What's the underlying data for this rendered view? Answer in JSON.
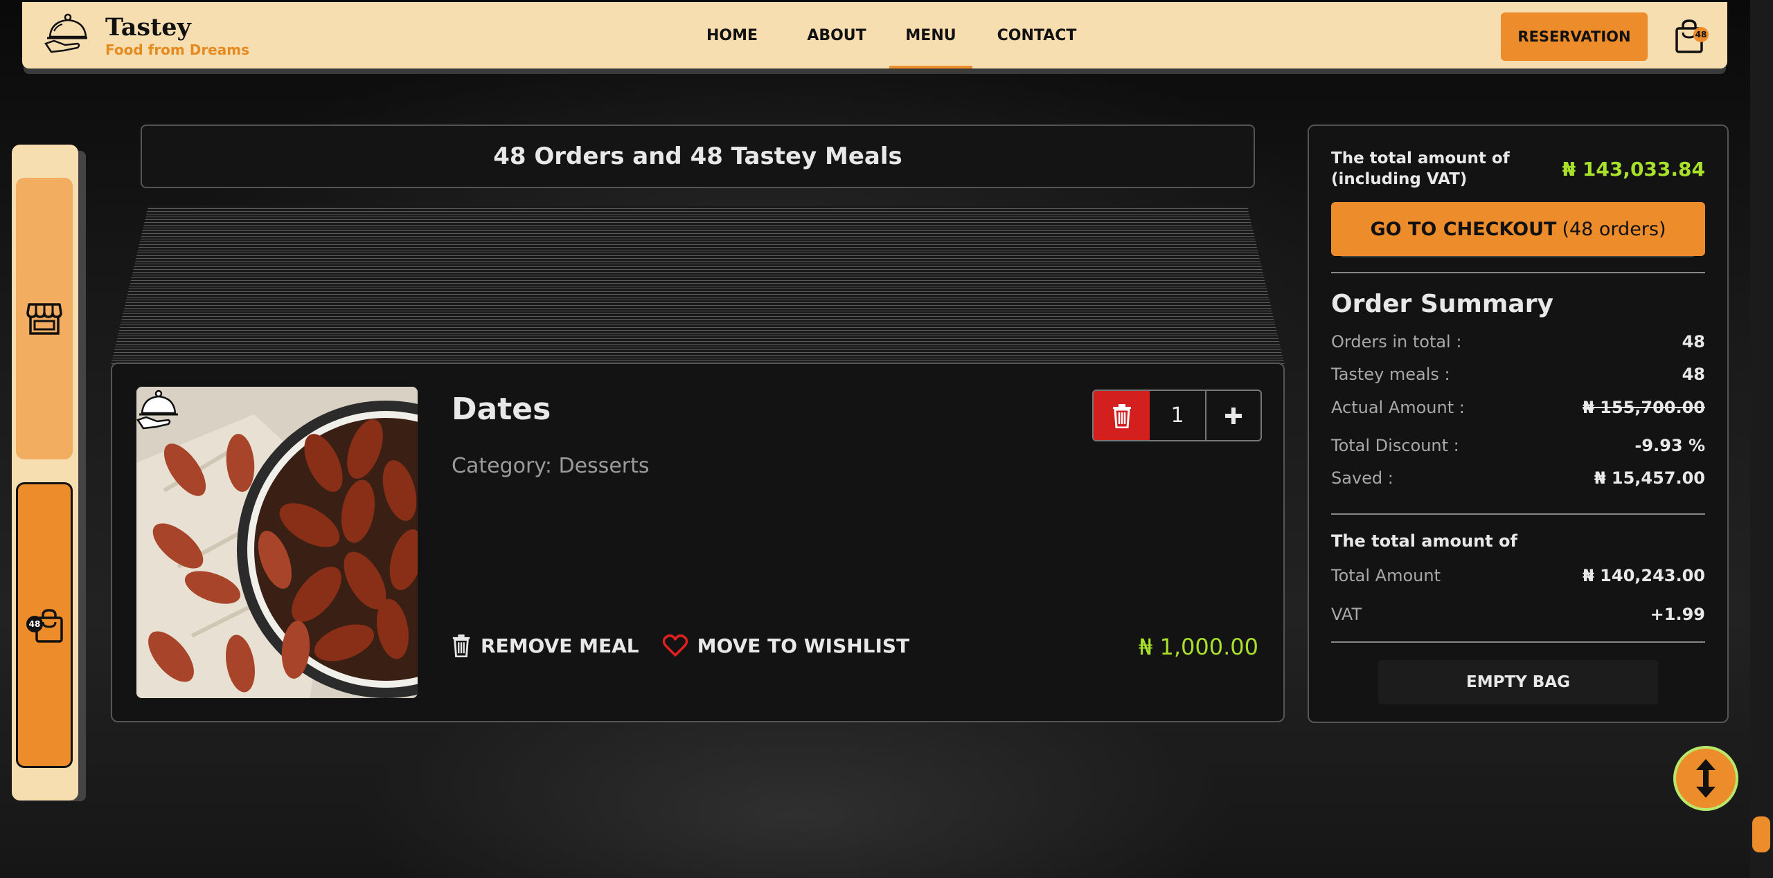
{
  "header": {
    "brand_name": "Tastey",
    "brand_tagline": "Food from Dreams",
    "nav": [
      {
        "label": "HOME"
      },
      {
        "label": "ABOUT"
      },
      {
        "label": "MENU",
        "active": true
      },
      {
        "label": "CONTACT"
      }
    ],
    "reservation_label": "RESERVATION",
    "bag_count": "48"
  },
  "sidebar": {
    "bag_count": "48"
  },
  "cart": {
    "title": "48 Orders and 48 Tastey Meals",
    "item": {
      "name": "Dates",
      "category": "Category: Desserts",
      "quantity": "1",
      "remove_label": "REMOVE MEAL",
      "wishlist_label": "MOVE TO WISHLIST",
      "price": "₦ 1,000.00"
    }
  },
  "summary": {
    "total_heading": "The total amount of (including VAT)",
    "total_value": "₦ 143,033.84",
    "checkout_label": "GO TO CHECKOUT",
    "checkout_count": "(48 orders)",
    "order_summary_title": "Order Summary",
    "rows": [
      {
        "label": "Orders in total :",
        "value": "48"
      },
      {
        "label": "Tastey meals :",
        "value": "48"
      },
      {
        "label": "Actual Amount :",
        "value": "₦ 155,700.00"
      },
      {
        "label": "Total Discount :",
        "value": "-9.93 %"
      },
      {
        "label": "Saved :",
        "value": "₦ 15,457.00"
      }
    ],
    "total_title": "The total amount of",
    "total_rows": [
      {
        "label": "Total Amount",
        "value": "₦ 140,243.00"
      },
      {
        "label": "VAT",
        "value": "+1.99"
      }
    ],
    "empty_bag_label": "EMPTY BAG"
  },
  "colors": {
    "accent": "#ed8c2a",
    "header_bg": "#f7deb0",
    "price_green": "#a8e02a",
    "delete_red": "#d41f1f"
  }
}
